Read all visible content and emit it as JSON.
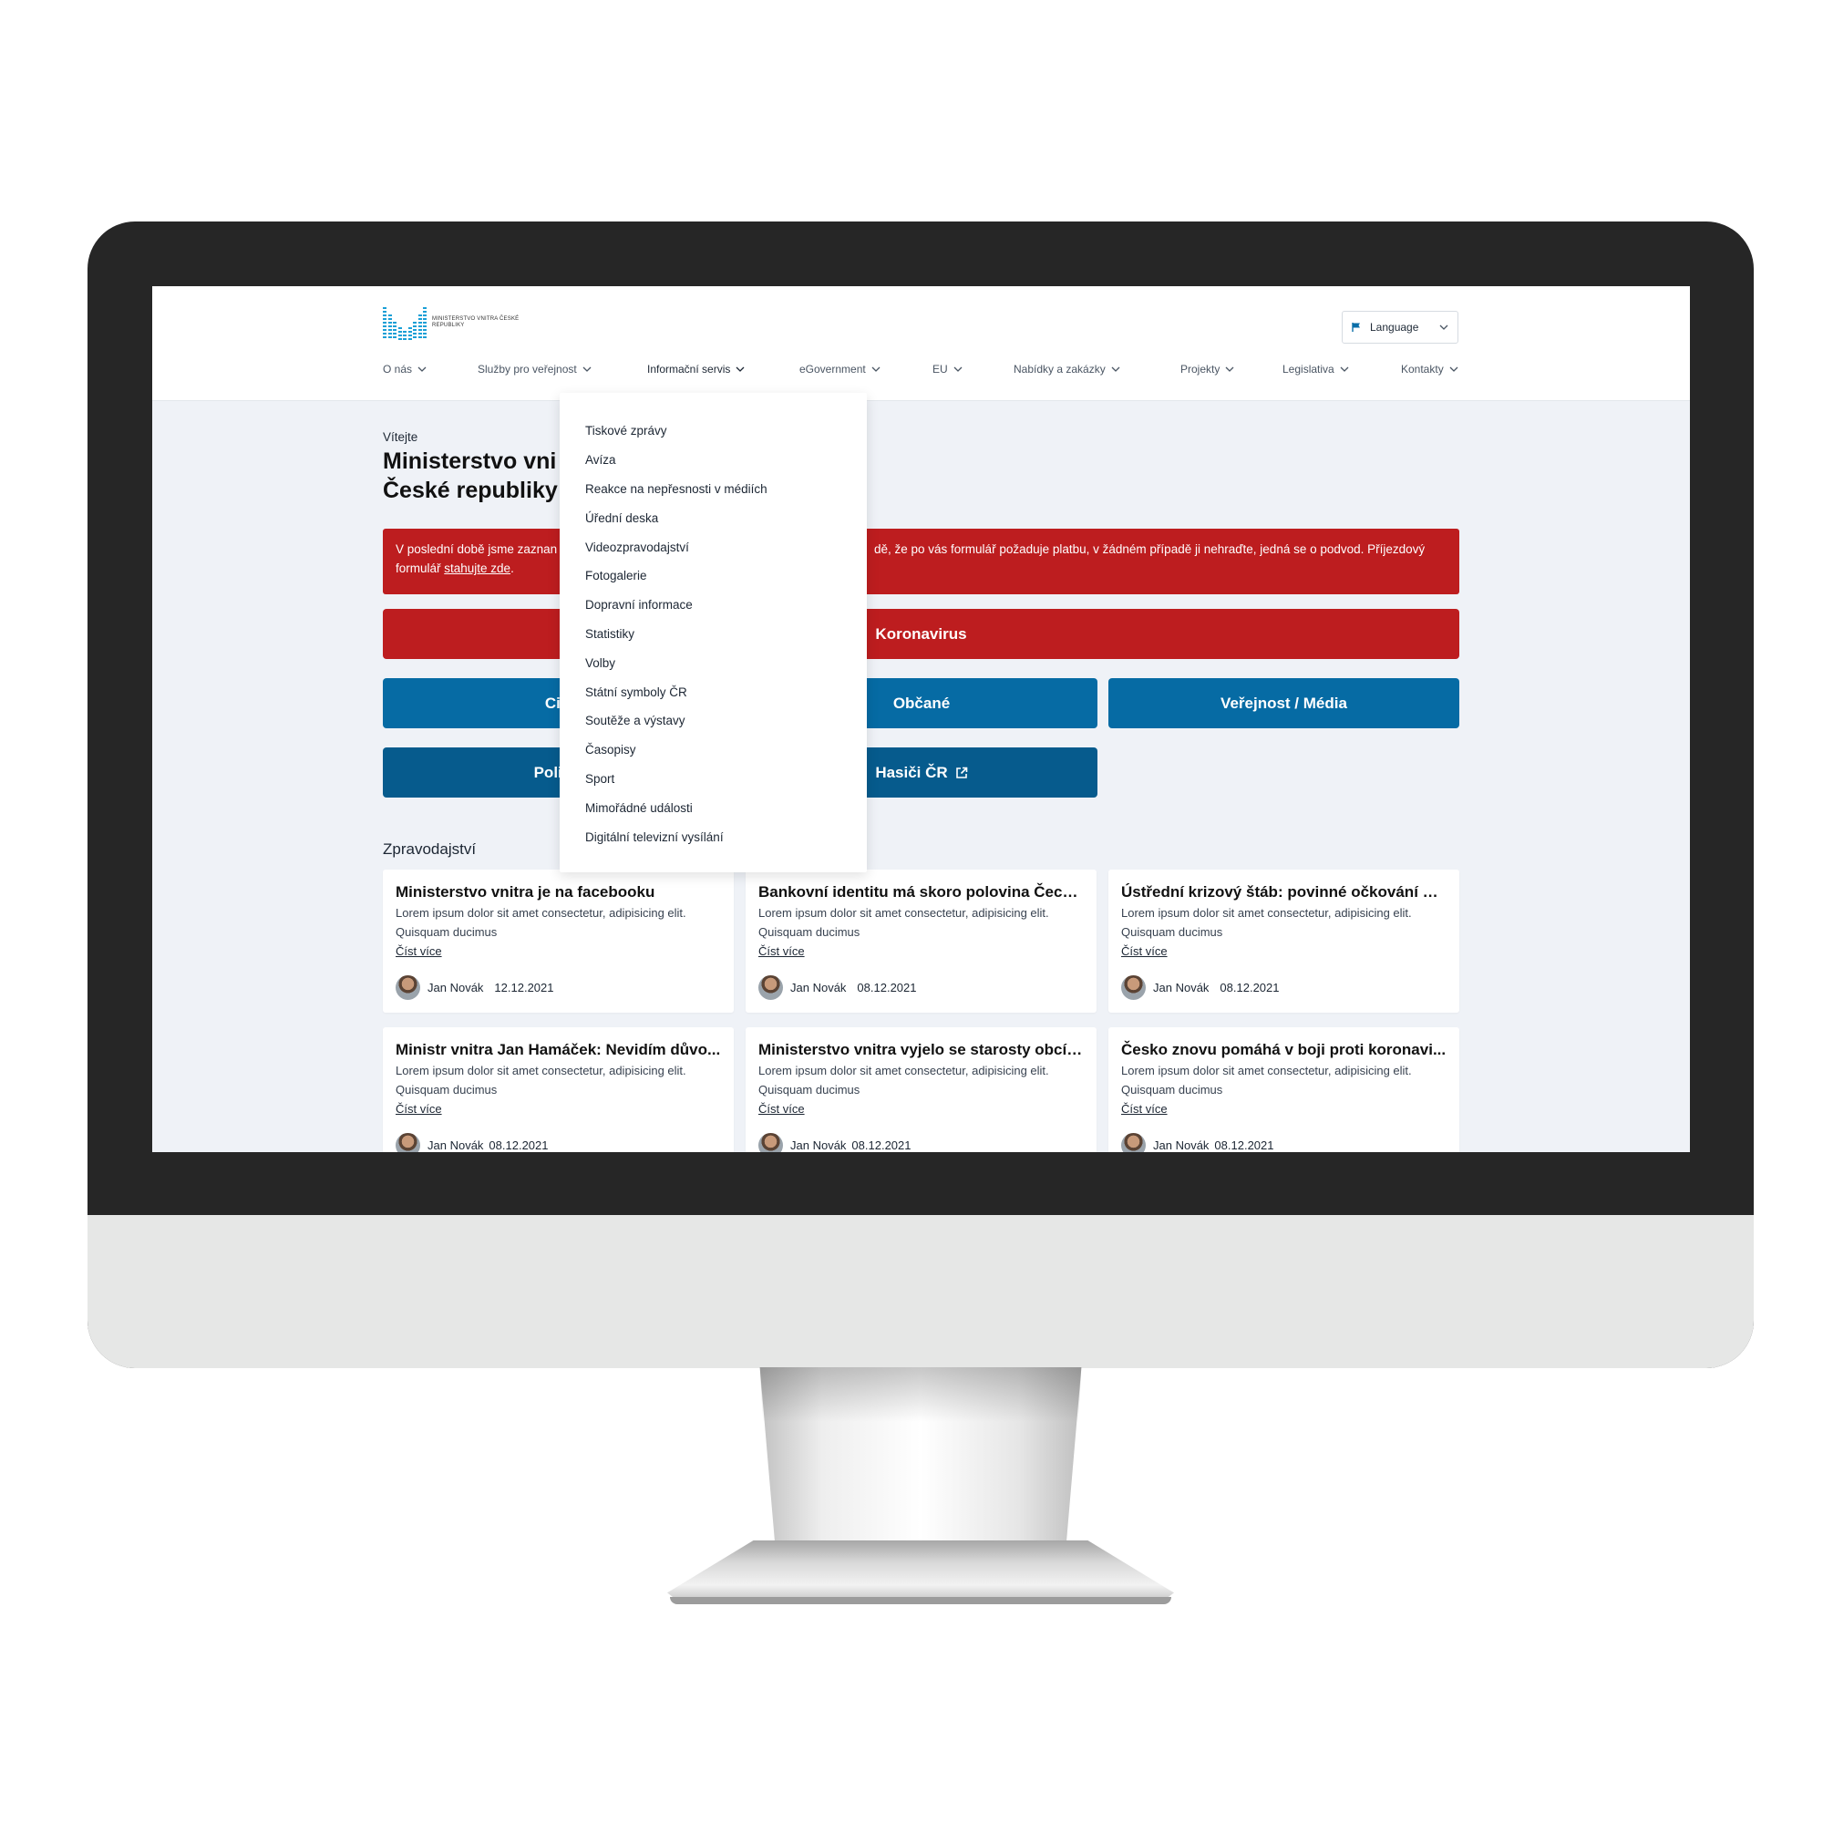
{
  "header": {
    "logo_text": "MINISTERSTVO VNITRA ČESKÉ REPUBLIKY",
    "language_label": "Language"
  },
  "nav": {
    "items": [
      {
        "label": "O nás"
      },
      {
        "label": "Služby pro veřejnost"
      },
      {
        "label": "Informační servis"
      },
      {
        "label": "eGovernment"
      },
      {
        "label": "EU"
      },
      {
        "label": "Nabídky a zakázky"
      },
      {
        "label": "Projekty"
      },
      {
        "label": "Legislativa"
      },
      {
        "label": "Kontakty"
      }
    ],
    "active": "Informační servis"
  },
  "dropdown": {
    "items": [
      "Tiskové zprávy",
      "Avíza",
      "Reakce na nepřesnosti v médiích",
      "Úřední deska",
      "Videozpravodajství",
      "Fotogalerie",
      "Dopravní informace",
      "Statistiky",
      "Volby",
      "Státní symboly ČR",
      "Soutěže a výstavy",
      "Časopisy",
      "Sport",
      "Mimořádné události",
      "Digitální televizní vysílání"
    ]
  },
  "hero": {
    "welcome": "Vítejte",
    "title_line1": "Ministerstvo vni",
    "title_line2": "České republiky"
  },
  "alert": {
    "text_left": "V poslední době jsme zaznan",
    "text_right": "dě, že po vás formulář požaduje platbu, v žádném případě ji nehraďte, jedná se o podvod. Příjezdový",
    "line2_prefix": "formulář ",
    "link": "stahujte zde",
    "line2_suffix": "."
  },
  "buttons": {
    "koronavirus": "Koronavirus",
    "cizinci": "Cizi",
    "obcane": "Občané",
    "verejnost": "Veřejnost / Média",
    "policie": "Policie",
    "hasici": "Hasiči ČR"
  },
  "news": {
    "heading": "Zpravodajství",
    "read_more": "Číst více",
    "cards": [
      {
        "title": "Ministerstvo vnitra je na facebooku",
        "text": "Lorem ipsum dolor sit amet consectetur, adipisicing elit. Quisquam ducimus",
        "author": "Jan Novák",
        "date": "12.12.2021"
      },
      {
        "title": "Bankovní identitu má skoro polovina Čech...",
        "text": "Lorem ipsum dolor sit amet consectetur, adipisicing elit. Quisquam ducimus",
        "author": "Jan Novák",
        "date": "08.12.2021"
      },
      {
        "title": "Ústřední krizový štáb: povinné očkování pr...",
        "text": "Lorem ipsum dolor sit amet consectetur, adipisicing elit. Quisquam ducimus",
        "author": "Jan Novák",
        "date": "08.12.2021"
      },
      {
        "title": "Ministr vnitra Jan Hamáček: Nevidím důvo...",
        "text": "Lorem ipsum dolor sit amet consectetur, adipisicing elit. Quisquam ducimus",
        "author": "Jan Novák",
        "date": "08.12.2021"
      },
      {
        "title": "Ministerstvo vnitra vyjelo se starosty obcí ...",
        "text": "Lorem ipsum dolor sit amet consectetur, adipisicing elit. Quisquam ducimus",
        "author": "Jan Novák",
        "date": "08.12.2021"
      },
      {
        "title": "Česko znovu pomáhá v boji proti koronavi...",
        "text": "Lorem ipsum dolor sit amet consectetur, adipisicing elit. Quisquam ducimus",
        "author": "Jan Novák",
        "date": "08.12.2021"
      }
    ]
  },
  "colors": {
    "brand_blue": "#066ba4",
    "dark_blue": "#065b8d",
    "alert_red": "#bd1d1f",
    "page_bg": "#eff2f7",
    "logo_blue": "#1a9fd6"
  }
}
